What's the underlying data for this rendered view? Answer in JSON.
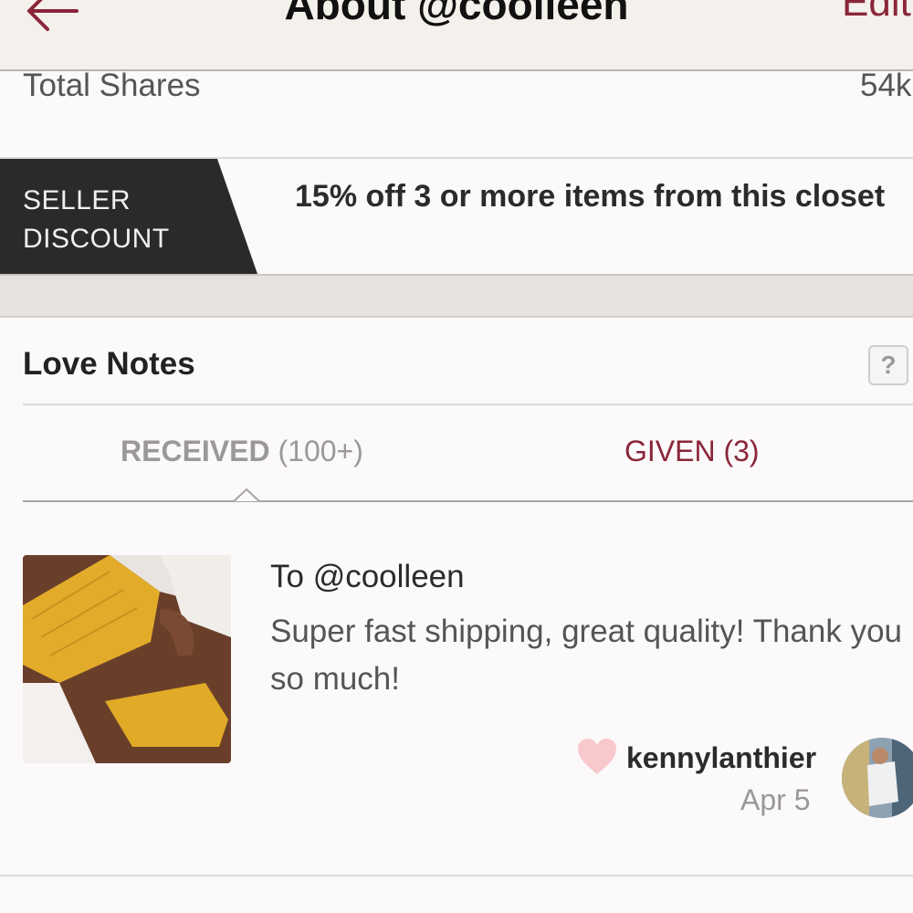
{
  "header": {
    "title": "About @coolleen",
    "edit_label": "Edit",
    "back_icon": "arrow-left-icon",
    "accent_color": "#8a2639"
  },
  "stats": {
    "total_shares_label": "Total Shares",
    "total_shares_value": "54k"
  },
  "seller_discount": {
    "badge_line1": "SELLER",
    "badge_line2": "DISCOUNT",
    "text": "15% off 3 or more items from this closet"
  },
  "love_notes": {
    "title": "Love Notes",
    "help_label": "?",
    "tabs": [
      {
        "label": "RECEIVED",
        "count": "(100+)",
        "active": true
      },
      {
        "label": "GIVEN (3)",
        "active": false
      }
    ],
    "notes": [
      {
        "to": "To @coolleen",
        "body": "Super fast shipping, great quality! Thank you so much!",
        "author": "kennylanthier",
        "date": "Apr 5",
        "heart_color": "#f8c8cc"
      }
    ]
  }
}
